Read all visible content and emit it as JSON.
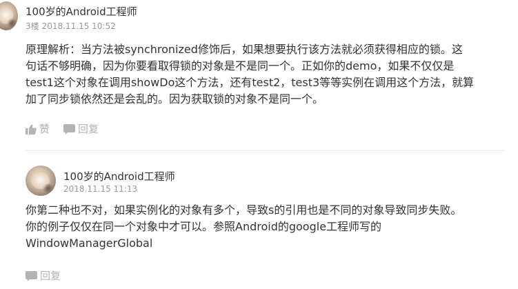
{
  "comments": [
    {
      "username": "100岁的Android工程师",
      "floor": "3楼",
      "timestamp": "2018.11.15 10:52",
      "lines": [
        "原理解析：当方法被synchronized修饰后，如果想要执行该方法就必须获得相应的锁。这",
        "句话不够明确，因为你要看取得锁的对象是不是同一个。正如你的demo，如果不仅仅是",
        "test1这个对象在调用showDo这个方法，还有test2，test3等等实例在调用这个方法，就算",
        "加了同步锁依然还是会乱的。因为获取锁的对象不是同一个。"
      ],
      "like_label": "赞",
      "reply_label": "回复"
    },
    {
      "username": "100岁的Android工程师",
      "timestamp": "2018.11.15 11:13",
      "lines": [
        "你第二种也不对，如果实例化的对象有多个，导致s的引用也是不同的对象导致同步失败。",
        "你的例子仅仅在同一个对象中才可以。参照Android的google工程师写的",
        "WindowManagerGlobal"
      ],
      "reply_label": "回复"
    }
  ],
  "icons": {
    "like": "thumbs-up-icon",
    "reply": "speech-bubble-icon"
  },
  "colors": {
    "text": "#333333",
    "meta": "#999999",
    "action": "#b3b3b3",
    "divider": "#e8e8e8"
  }
}
